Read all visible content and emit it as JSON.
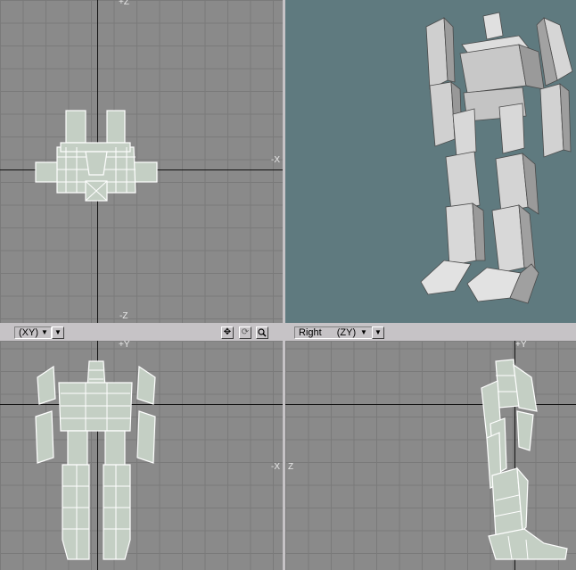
{
  "viewports": {
    "top": {
      "axis_label_top": "+Z",
      "axis_label_right": "-X",
      "axis_label_bottom": "-Z"
    },
    "perspective": {},
    "back": {
      "mode_label": "(XY)",
      "axis_label_top": "+Y",
      "axis_label_right": "-X",
      "tools": [
        "move-icon",
        "rotate-icon",
        "zoom-icon"
      ]
    },
    "right": {
      "view_label": "Right",
      "mode_label": "(ZY)",
      "axis_label_top": "+Y",
      "axis_label_left": "Z"
    }
  },
  "colors": {
    "grid_background": "#8a8a8a",
    "perspective_background": "#5f7a7f",
    "wireframe_fill": "#c4cfc4",
    "wireframe_stroke": "#ffffff",
    "toolbar": "#c6c3c6"
  }
}
